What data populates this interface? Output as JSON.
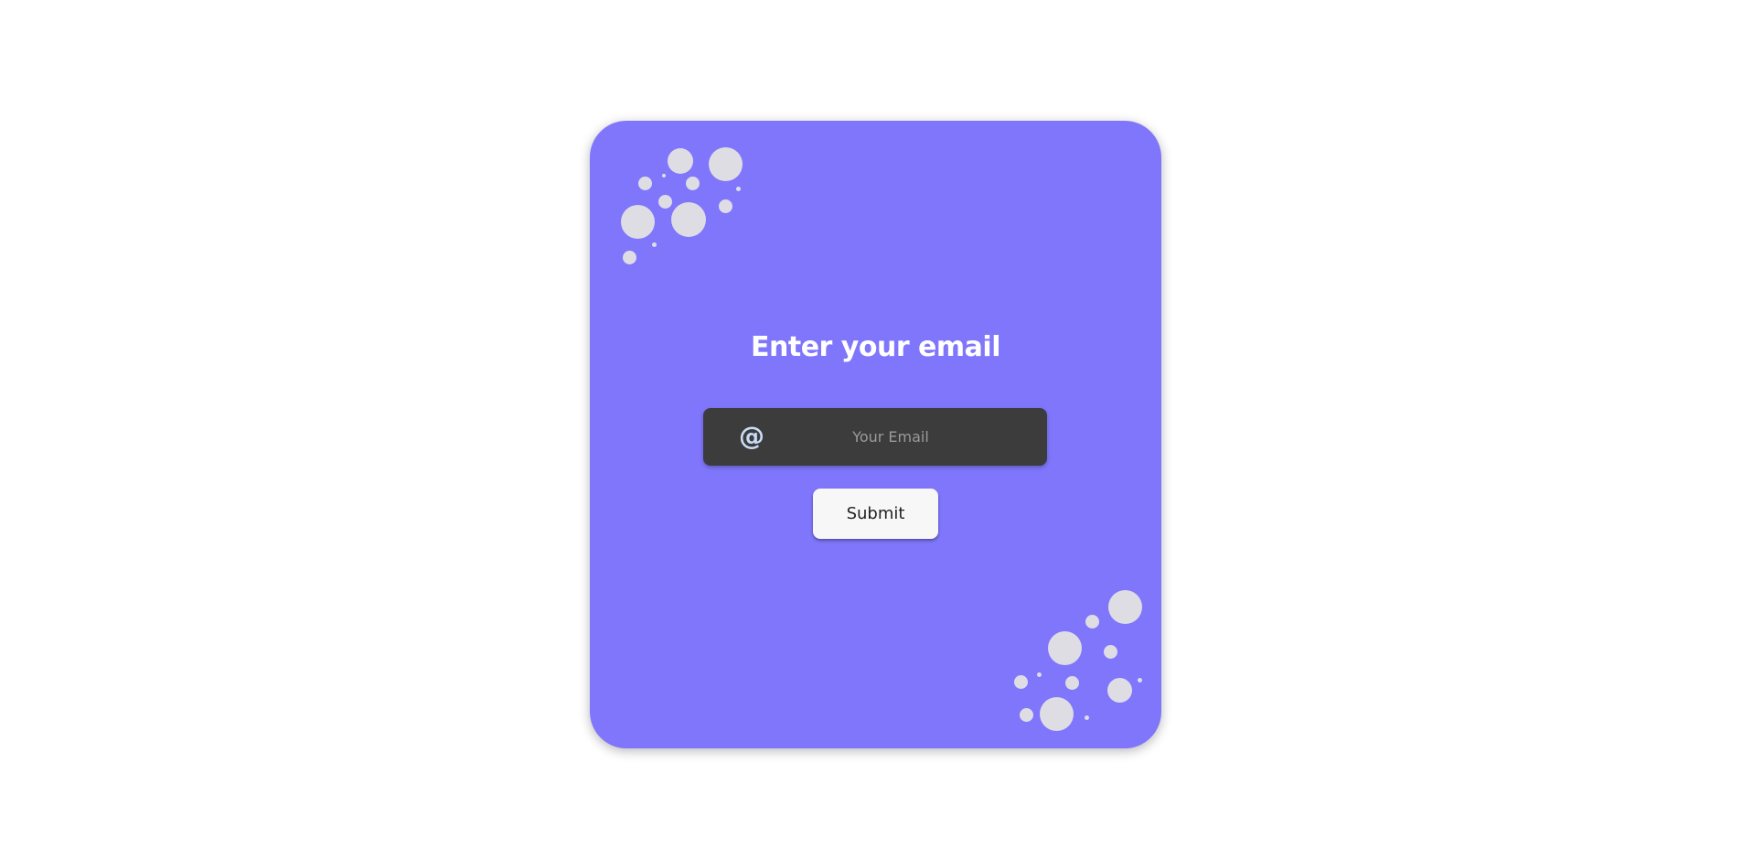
{
  "form": {
    "title": "Enter your email",
    "email_placeholder": "Your Email",
    "email_value": "",
    "email_icon": "at-sign-icon",
    "submit_label": "Submit"
  },
  "colors": {
    "card_background": "#7f76fb",
    "input_background": "#3c3c3c",
    "decoration_dots": "#dedde4",
    "button_background": "#f7f7f8"
  }
}
